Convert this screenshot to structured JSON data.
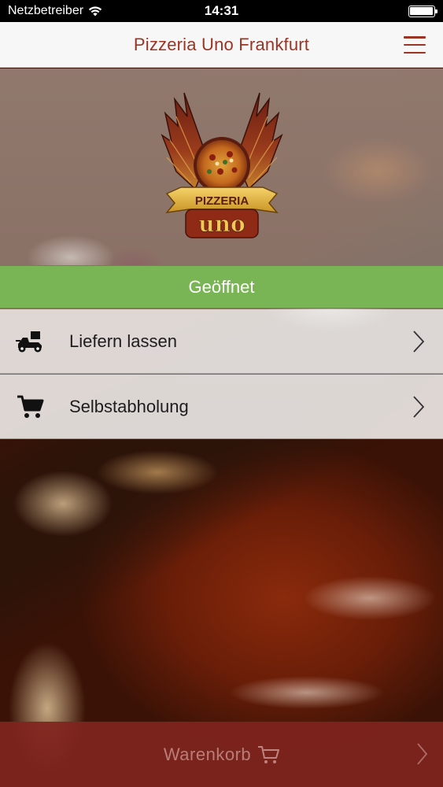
{
  "status_bar": {
    "carrier": "Netzbetreiber",
    "time": "14:31",
    "wifi_icon": "wifi-icon",
    "battery_icon": "battery-full-icon"
  },
  "nav": {
    "title": "Pizzeria Uno Frankfurt",
    "menu_icon": "hamburger-menu-icon",
    "title_color": "#9a3423"
  },
  "logo": {
    "top_word": "PIZZERIA",
    "bottom_word": "uno"
  },
  "open_status": {
    "label": "Geöffnet",
    "color": "#79b554"
  },
  "menu": {
    "items": [
      {
        "label": "Liefern lassen",
        "icon": "delivery-scooter-icon"
      },
      {
        "label": "Selbstabholung",
        "icon": "shopping-cart-icon"
      }
    ]
  },
  "cart": {
    "label": "Warenkorb",
    "icon": "shopping-cart-icon",
    "color": "#80241e"
  }
}
